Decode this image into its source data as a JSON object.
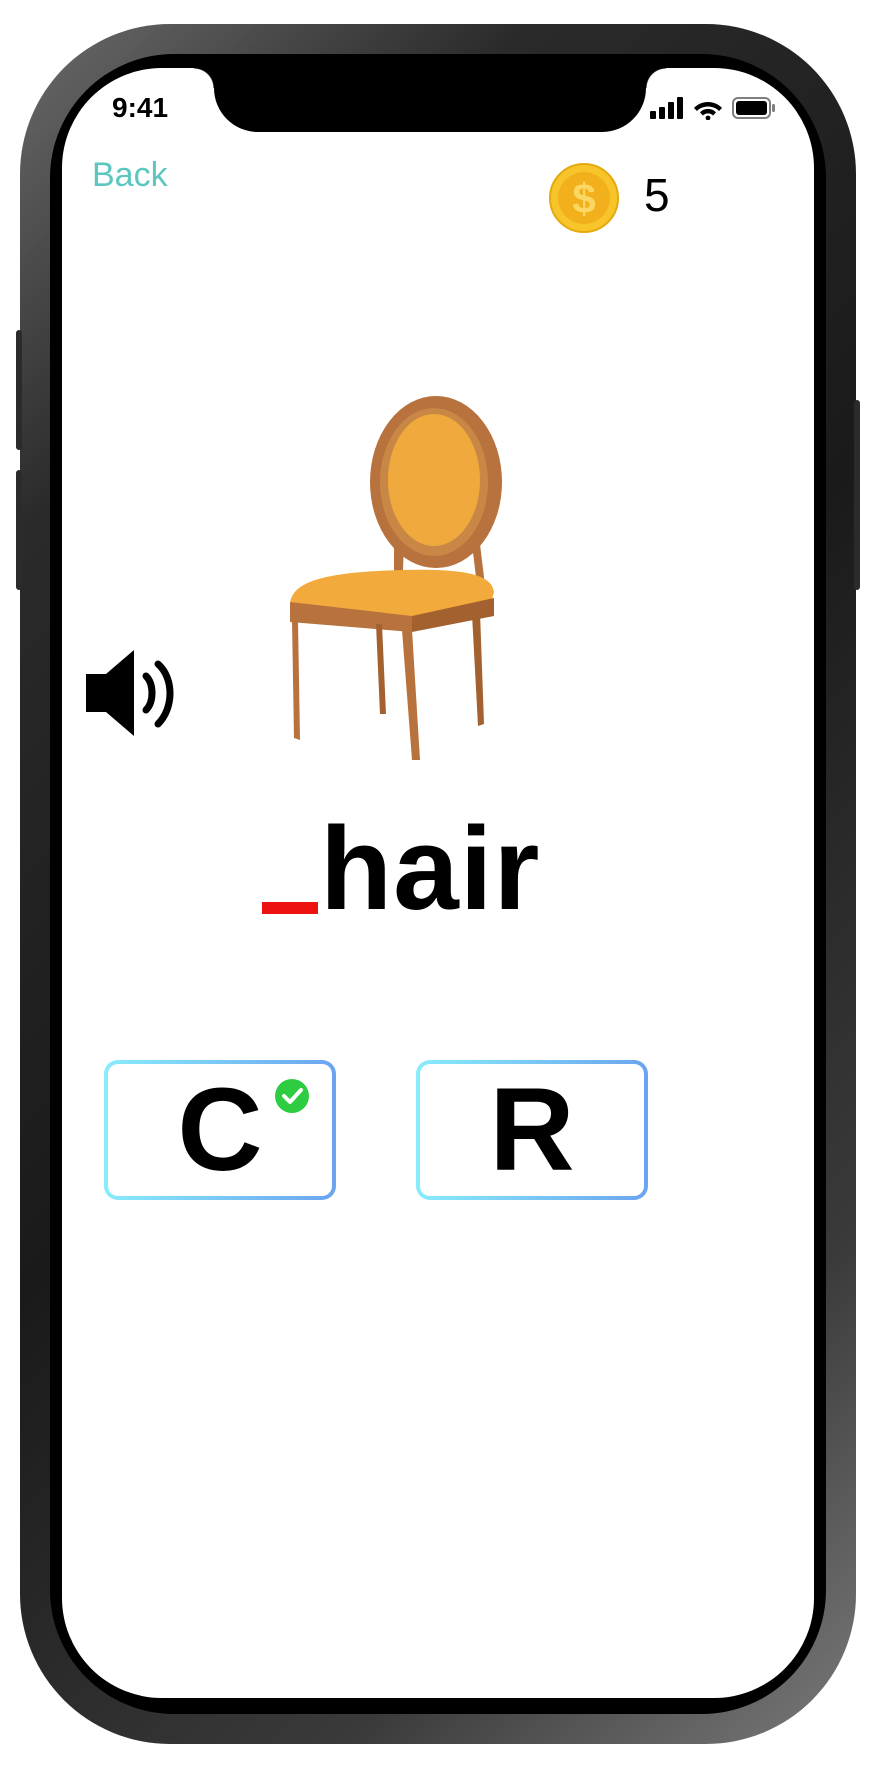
{
  "status_bar": {
    "time": "9:41",
    "signal_icon": "signal-bars-icon",
    "wifi_icon": "wifi-icon",
    "battery_icon": "battery-icon"
  },
  "nav": {
    "back_label": "Back"
  },
  "coins": {
    "icon": "coin-dollar-icon",
    "count": "5",
    "icon_symbol": "$"
  },
  "prompt": {
    "image": "chair-image",
    "audio_icon": "speaker-volume-icon",
    "word_suffix": "hair",
    "blank_color": "#ee1111"
  },
  "choices": [
    {
      "letter": "C",
      "correct_badge": true
    },
    {
      "letter": "R",
      "correct_badge": false
    }
  ],
  "colors": {
    "accent": "#5cc7c0",
    "border_start": "#88ecfb",
    "border_end": "#6ba4ef",
    "coin": "#f4c020",
    "check": "#2ecc40"
  }
}
